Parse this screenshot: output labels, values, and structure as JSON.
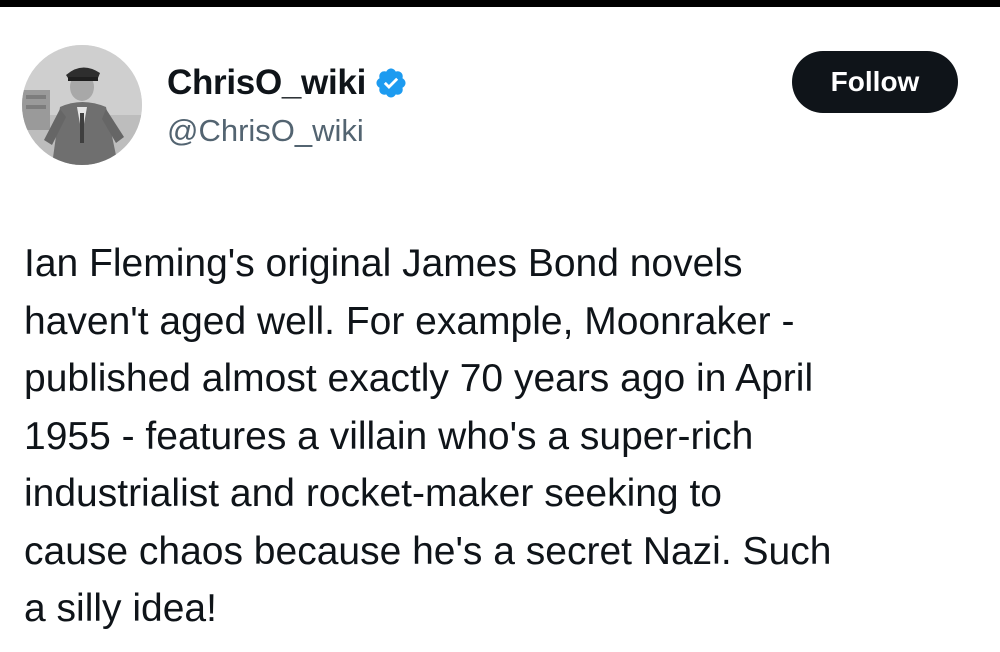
{
  "author": {
    "display_name": "ChrisO_wiki",
    "handle": "@ChrisO_wiki",
    "verified": true,
    "avatar_icon": "profile-photo-officer-in-uniform"
  },
  "actions": {
    "follow_label": "Follow"
  },
  "tweet": {
    "lines": [
      "Ian Fleming's original James Bond novels",
      "haven't aged well. For example, Moonraker -",
      "published almost exactly 70 years ago in April",
      "1955 - features a villain who's a super-rich",
      "industrialist and rocket-maker seeking to",
      "cause chaos because he's a secret Nazi. Such",
      "a silly idea!"
    ]
  },
  "colors": {
    "text_primary": "#0f1419",
    "text_secondary": "#536471",
    "verified_blue": "#1d9bf0",
    "follow_bg": "#0f1419"
  }
}
